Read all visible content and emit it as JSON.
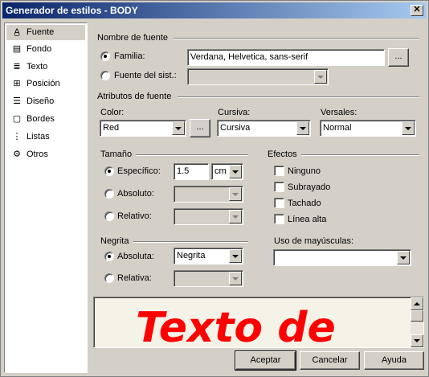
{
  "window": {
    "title": "Generador de estilos - BODY",
    "close_glyph": "✕"
  },
  "sidebar": {
    "items": [
      {
        "label": "Fuente",
        "icon": "font-icon",
        "glyph": "A̲",
        "selected": true
      },
      {
        "label": "Fondo",
        "icon": "background-icon",
        "glyph": "▤"
      },
      {
        "label": "Texto",
        "icon": "text-icon",
        "glyph": "≣"
      },
      {
        "label": "Posición",
        "icon": "position-icon",
        "glyph": "⊞"
      },
      {
        "label": "Diseño",
        "icon": "layout-icon",
        "glyph": "☰"
      },
      {
        "label": "Bordes",
        "icon": "borders-icon",
        "glyph": "▢"
      },
      {
        "label": "Listas",
        "icon": "lists-icon",
        "glyph": "⋮"
      },
      {
        "label": "Otros",
        "icon": "other-icon",
        "glyph": "⚙"
      }
    ]
  },
  "font_name": {
    "group_label": "Nombre de fuente",
    "family_label": "Familia:",
    "family_value": "Verdana, Helvetica, sans-serif",
    "system_label": "Fuente del sist.:",
    "system_value": "",
    "browse_label": "..."
  },
  "font_attributes": {
    "group_label": "Atributos de fuente",
    "color_label": "Color:",
    "color_value": "Red",
    "color_browse": "...",
    "italic_label": "Cursiva:",
    "italic_value": "Cursiva",
    "smallcaps_label": "Versales:",
    "smallcaps_value": "Normal"
  },
  "size": {
    "group_label": "Tamaño",
    "specific_label": "Específico:",
    "specific_value": "1.5",
    "unit_value": "cm",
    "absolute_label": "Absoluto:",
    "relative_label": "Relativo:"
  },
  "effects": {
    "group_label": "Efectos",
    "none_label": "Ninguno",
    "underline_label": "Subrayado",
    "strikethrough_label": "Tachado",
    "overline_label": "Línea alta"
  },
  "bold": {
    "group_label": "Negrita",
    "absolute_label": "Absoluta:",
    "absolute_value": "Negrita",
    "relative_label": "Relativa:"
  },
  "capitalization": {
    "label": "Uso de mayúsculas:",
    "value": ""
  },
  "preview": {
    "text": "Texto de",
    "color": "#ff0000"
  },
  "buttons": {
    "ok": "Aceptar",
    "cancel": "Cancelar",
    "help": "Ayuda"
  }
}
